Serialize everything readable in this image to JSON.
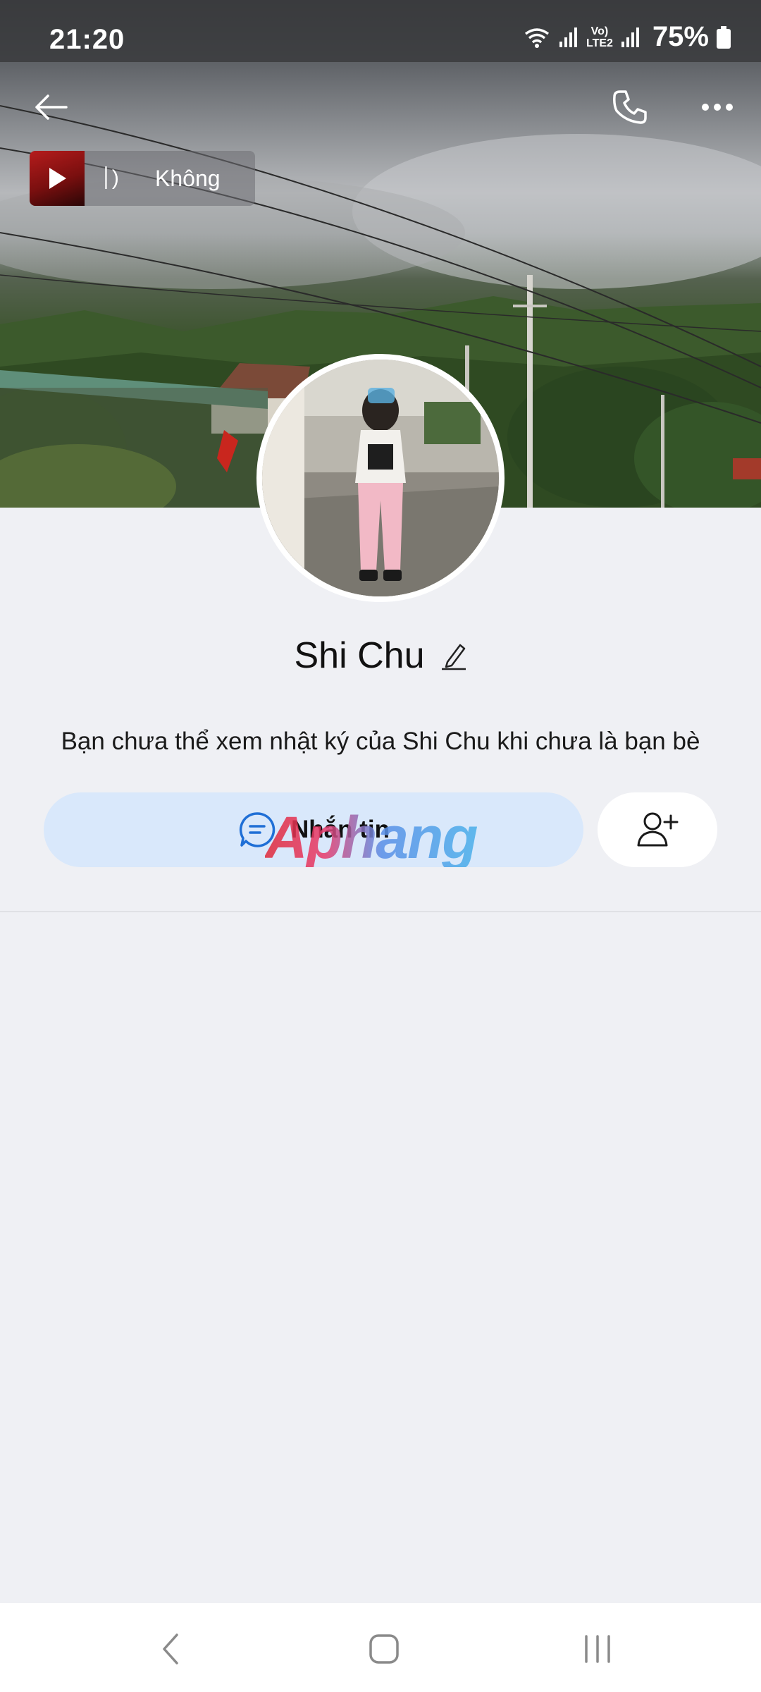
{
  "status_bar": {
    "time": "21:20",
    "network_label_top": "Vo)",
    "network_label_bottom": "LTE2",
    "battery": "75%"
  },
  "music": {
    "eq_text": "׀)",
    "title": "Không"
  },
  "profile": {
    "name": "Shi Chu",
    "privacy_note": "Bạn chưa thể xem nhật ký của Shi Chu khi chưa là bạn bè"
  },
  "actions": {
    "message_label": "Nhắn tin"
  },
  "watermark": "Aphang",
  "icons": {
    "back": "arrow-left-icon",
    "call": "phone-icon",
    "more": "more-horizontal-icon",
    "edit": "pencil-icon",
    "message": "chat-bubble-icon",
    "add_friend": "user-plus-icon"
  },
  "colors": {
    "background": "#eff0f4",
    "message_button_bg": "#d9e8fb",
    "accent": "#1f6fd6"
  }
}
